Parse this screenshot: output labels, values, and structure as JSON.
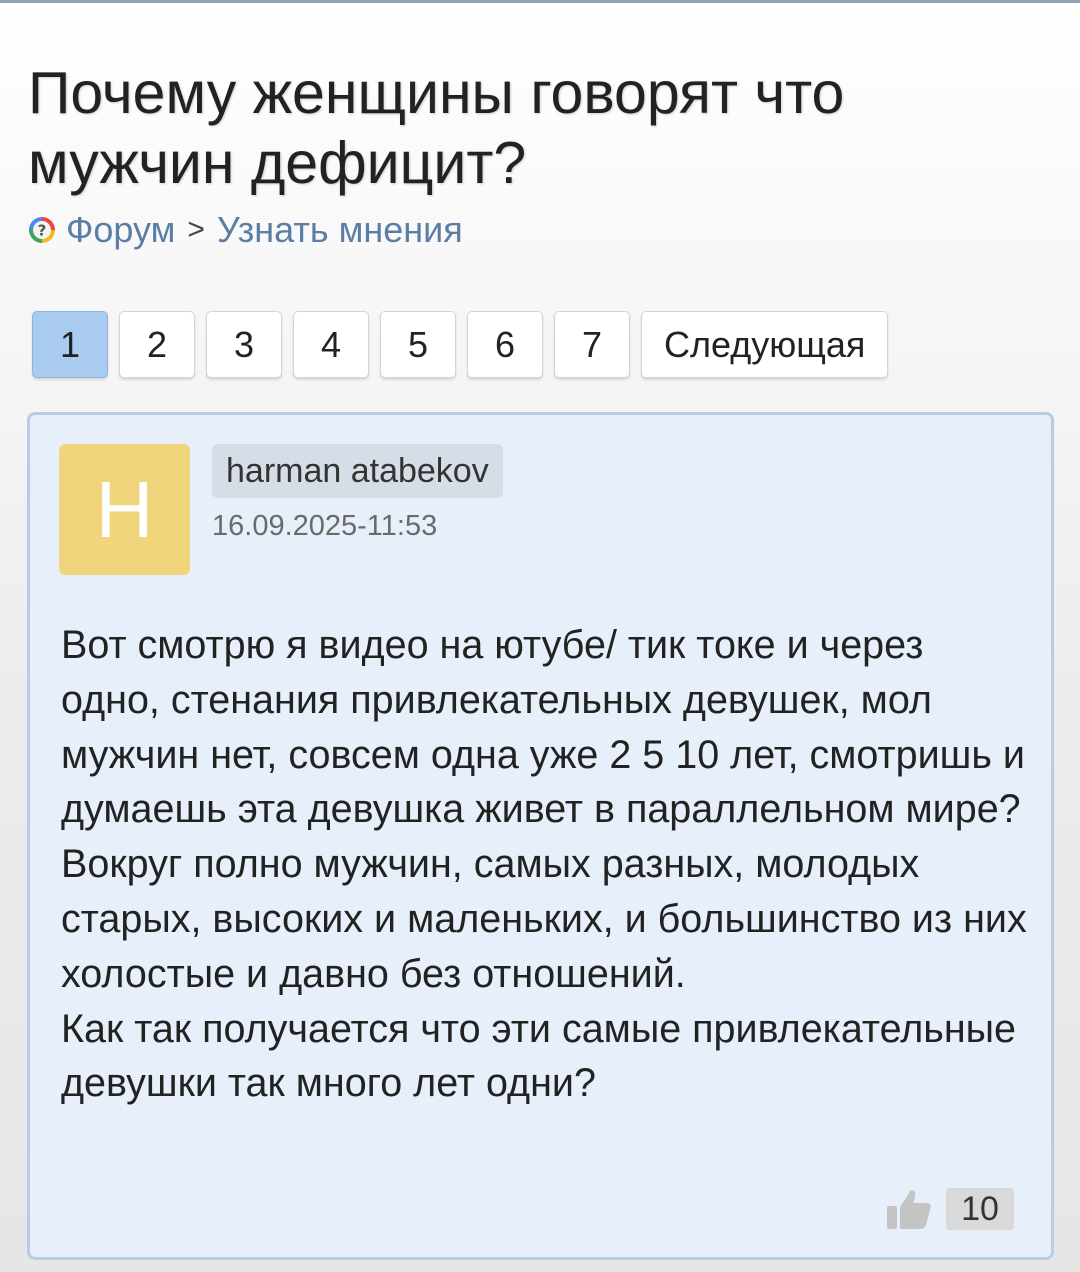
{
  "question": {
    "title": "Почему женщины говорят что мужчин дефицит?"
  },
  "breadcrumb": {
    "icon": "question-circle-icon",
    "forum": "Форум",
    "separator": ">",
    "section": "Узнать мнения"
  },
  "pagination": {
    "pages": [
      "1",
      "2",
      "3",
      "4",
      "5",
      "6",
      "7"
    ],
    "active_page": "1",
    "next_label": "Следующая"
  },
  "post": {
    "avatar_letter": "H",
    "author": "harman atabekov",
    "date": "16.09.2025-11:53",
    "text_paragraph_1": "Вот смотрю я видео на ютубе/ тик токе и через одно, стенания привлекательных девушек, мол мужчин нет, совсем одна уже 2 5 10 лет, смотришь и думаешь эта девушка живет в параллельном мире? Вокруг полно мужчин, самых разных, молодых старых, высоких и маленьких, и большинство из них холостые и давно без отношений.",
    "text_paragraph_2": "Как так получается что эти самые привлекательные девушки так много лет одни?",
    "likes": "10",
    "like_icon": "thumbs-up-icon"
  },
  "colors": {
    "link": "#5d7ea4",
    "active_page": "#a8cbef",
    "post_background": "#e7f0fa",
    "post_border": "#b8cde4",
    "avatar": "#f1d57c"
  }
}
